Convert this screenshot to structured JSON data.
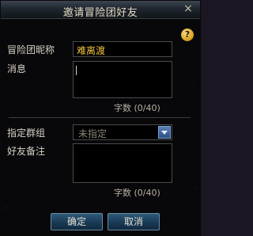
{
  "dialog": {
    "title": "邀请冒险团好友",
    "close_glyph": "×",
    "help_glyph": "?"
  },
  "form": {
    "nickname_label": "冒险团昵称",
    "nickname_value": "难离渡",
    "message_label": "消息",
    "message_value": "",
    "message_counter": "字数 (0/40)",
    "group_label": "指定群组",
    "group_selected": "未指定",
    "remark_label": "好友备注",
    "remark_value": "",
    "remark_counter": "字数 (0/40)"
  },
  "buttons": {
    "confirm": "确定",
    "cancel": "取消"
  },
  "colors": {
    "nickname_text": "#f1c23e",
    "dropdown_arrow": "#3d63a0",
    "button_face": "#1f4664"
  },
  "icons": {
    "close": "close-icon",
    "help": "help-icon",
    "dropdown": "chevron-down-icon"
  }
}
